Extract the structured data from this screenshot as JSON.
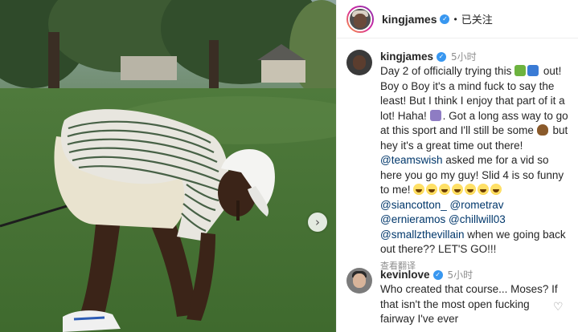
{
  "colors": {
    "verified": "#3897f0",
    "mention": "#00376b",
    "muted": "#8e8e8e"
  },
  "photo": {
    "next_icon": "chevron-right-icon",
    "next_glyph": "›"
  },
  "header": {
    "username": "kingjames",
    "separator": "•",
    "follow_label": "已关注",
    "verified_glyph": "✓"
  },
  "caption": {
    "username": "kingjames",
    "time": "5小时",
    "text_1": "Day 2 of officially trying this",
    "text_2": "out! Boy o Boy it's a mind fuck to say the least! But I think I enjoy that part of it a lot! Haha!",
    "text_3": ". Got a long ass way to go at this sport and I'll still be some",
    "text_4": "but hey it's a great time out there!",
    "mention_1": "@teamswish",
    "text_5": "asked me for a vid so here you go my guy! Slid 4 is so funny to me!",
    "mention_2": "@siancotton_",
    "mention_3": "@rometrav",
    "mention_4": "@ernieramos",
    "mention_5": "@chillwill03",
    "mention_6": "@smallzthevillain",
    "text_6": "when we going back out there?? LET'S GO!!!",
    "translate": "查看翻译"
  },
  "reply": {
    "username": "kevinlove",
    "time": "5小时",
    "text": "Who created that course... Moses? If that isn't the most open fucking fairway I've ever",
    "like_icon": "heart-icon",
    "like_glyph": "♡"
  }
}
